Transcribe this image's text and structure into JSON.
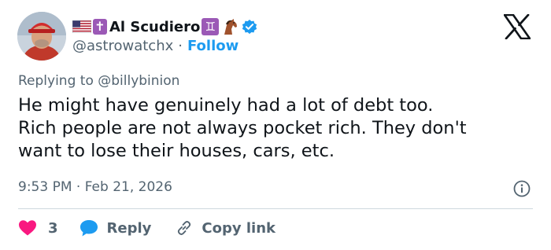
{
  "author": {
    "display_name": "Al Scudiero",
    "handle": "@astrowatchx",
    "separator": "·",
    "follow_label": "Follow",
    "cross_emoji": "✝",
    "zodiac_emoji": "♊",
    "icons": [
      "us-flag-icon",
      "cross-icon",
      "gemini-icon",
      "horse-icon",
      "verified-badge-icon"
    ],
    "verified_color": "#1d9bf0"
  },
  "platform": {
    "logo_icon": "x-logo-icon"
  },
  "replying_to": "Replying to @billybinion",
  "tweet": {
    "lines": [
      "He might have genuinely had a lot of debt too.",
      "Rich people are not always pocket rich. They don't",
      "want to lose their houses, cars, etc."
    ]
  },
  "timestamp": "9:53 PM · Feb 21, 2026",
  "actions": {
    "like_count": "3",
    "reply_label": "Reply",
    "copy_link_label": "Copy link"
  },
  "colors": {
    "accent": "#1d9bf0",
    "like": "#f91880",
    "secondary_text": "#536471",
    "divider": "#cfd9de"
  }
}
